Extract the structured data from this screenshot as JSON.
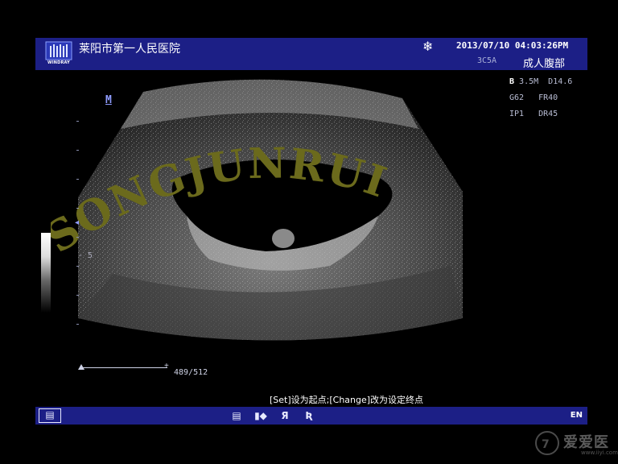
{
  "header": {
    "logo_text": "WINDRAY",
    "hospital_name": "莱阳市第一人民医院",
    "freeze_icon": "snowflake-icon",
    "datetime": "2013/07/10  04:03:26PM",
    "probe": "3C5A",
    "preset": "成人腹部"
  },
  "params": {
    "line1_mode": "B",
    "line1_rest": " 3.5M  D14.6",
    "line2": "G62   FR40",
    "line3": "IP1   DR45"
  },
  "image": {
    "marker": "M",
    "depth_label": "5",
    "watermark": "SONGJUNRUI"
  },
  "measurement": {
    "value": "489/512"
  },
  "hint": "[Set]设为起点;[Change]改为设定终点",
  "footer": {
    "lang": "EN",
    "icons": [
      "keyboard-icon",
      "document-icon",
      "cine-icon",
      "rotate-r-icon",
      "rotate-l-icon"
    ]
  },
  "brand": {
    "name": "爱爱医",
    "url": "www.iiyi.com"
  }
}
